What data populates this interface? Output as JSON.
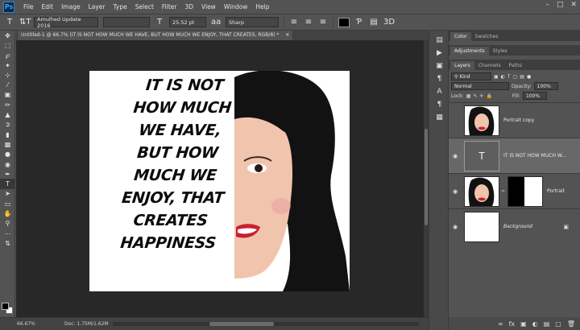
{
  "menu": {
    "logo": "Ps",
    "items": [
      "File",
      "Edit",
      "Image",
      "Layer",
      "Type",
      "Select",
      "Filter",
      "3D",
      "View",
      "Window",
      "Help"
    ],
    "window_controls": [
      "–",
      "□",
      "✕"
    ]
  },
  "options": {
    "tool_icon": "T",
    "orient_icon": "⇅T",
    "font_family": "Amulhed Update 2016",
    "font_style": "",
    "size_icon": "T",
    "font_size": "25.52 pt",
    "aa_icon": "aa",
    "antialias": "Sharp",
    "text_color": "#000000"
  },
  "document_tab": {
    "title": "Untitled-1 @ 66.7% (IT IS NOT HOW MUCH WE HAVE, BUT HOW MUCH WE ENJOY, THAT CREATES, RGB/8) *",
    "close": "✕"
  },
  "canvas": {
    "quote_lines": [
      "IT IS NOT",
      "HOW MUCH",
      "WE HAVE,",
      "BUT HOW",
      "MUCH WE",
      "ENJOY, THAT",
      "CREATES",
      "HAPPINESS"
    ]
  },
  "status": {
    "zoom": "66.67%",
    "doc_info": "Doc: 1.75M/1.62M",
    "arrow": "›"
  },
  "dock_icons": [
    "▤",
    "▶",
    "▣",
    "¶",
    "A",
    "¶",
    "▦"
  ],
  "panels": {
    "top_tabs": [
      "Color",
      "Swatches"
    ],
    "mid_tabs": [
      "Adjustments",
      "Styles"
    ],
    "layer_tabs": [
      "Layers",
      "Channels",
      "Paths"
    ],
    "kind_label": "Kind",
    "filter_icons": [
      "▣",
      "◐",
      "T",
      "▢",
      "▤",
      "●"
    ],
    "blend_mode": "Normal",
    "opacity_label": "Opacity:",
    "opacity": "100%",
    "lock_label": "Lock:",
    "lock_icons": [
      "▦",
      "✎",
      "✛",
      "🔒"
    ],
    "fill_label": "Fill:",
    "fill": "100%",
    "layers": [
      {
        "name": "Portrait copy",
        "visible": false
      },
      {
        "name": "IT IS NOT HOW MUCH W...",
        "visible": true,
        "selected": true
      },
      {
        "name": "Portrait",
        "visible": true,
        "has_mask": true
      },
      {
        "name": "Background",
        "visible": true,
        "locked": true
      }
    ],
    "footer_icons": [
      "∞",
      "fx",
      "▣",
      "◐",
      "▤",
      "▢",
      "🗑"
    ]
  },
  "colors": {
    "ui_bg": "#535353",
    "canvas_bg": "#282828",
    "selected_layer": "#686868",
    "lip": "#c8202f",
    "hair": "#121212",
    "skin": "#f1c4ad"
  }
}
